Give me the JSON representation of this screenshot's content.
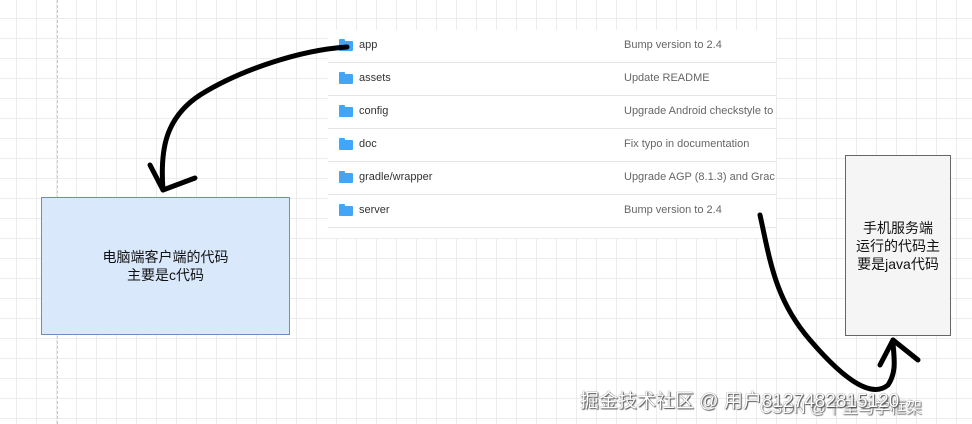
{
  "file_list": [
    {
      "name": "app",
      "message": "Bump version to 2.4"
    },
    {
      "name": "assets",
      "message": "Update README"
    },
    {
      "name": "config",
      "message": "Upgrade Android checkstyle to"
    },
    {
      "name": "doc",
      "message": "Fix typo in documentation"
    },
    {
      "name": "gradle/wrapper",
      "message": "Upgrade AGP (8.1.3) and Grac"
    },
    {
      "name": "server",
      "message": "Bump version to 2.4"
    }
  ],
  "boxes": {
    "client": {
      "line1": "电脑端客户端的代码",
      "line2": "主要是c代码"
    },
    "server": {
      "line1": "手机服务端",
      "line2": "运行的代码主",
      "line3": "要是java代码"
    }
  },
  "watermarks": {
    "juejin": "掘金技术社区 @ 用户8127482815120",
    "csdn": "CSDN @千里马学框架"
  },
  "colors": {
    "folder": "#42a5f5",
    "client_fill": "#dae8fc",
    "client_border": "#6c8ebf",
    "server_fill": "#f5f5f5"
  }
}
